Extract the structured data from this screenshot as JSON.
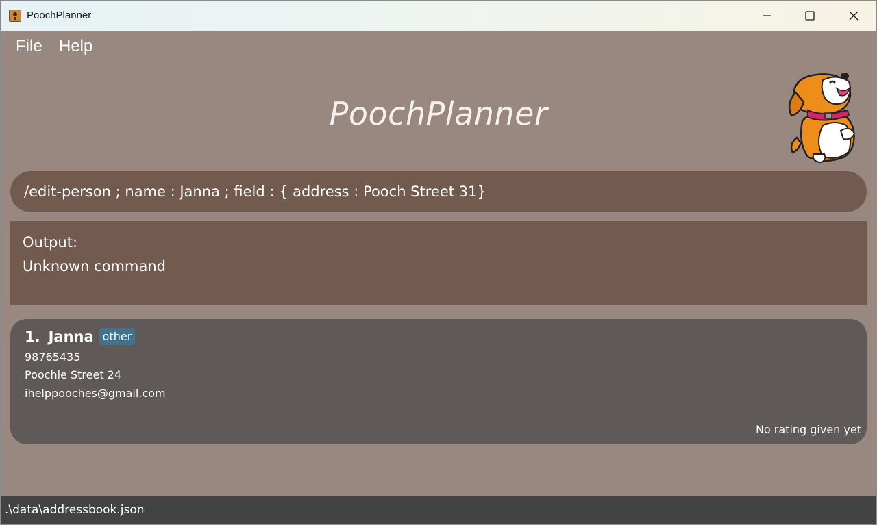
{
  "window": {
    "title": "PoochPlanner"
  },
  "menu": {
    "file_label": "File",
    "help_label": "Help"
  },
  "app": {
    "title": "PoochPlanner"
  },
  "command": {
    "value": "/edit-person ; name : Janna ; field : { address : Pooch Street 31}"
  },
  "output": {
    "label": "Output:",
    "message": "Unknown command"
  },
  "contacts": [
    {
      "index": "1.",
      "name": "Janna",
      "tag": "other",
      "phone": "98765435",
      "address": "Poochie Street 24",
      "email": "ihelppooches@gmail.com",
      "rating": "No rating given yet"
    }
  ],
  "status": {
    "path": ".\\data\\addressbook.json"
  },
  "icons": {
    "app": "dog-app-icon",
    "mascot": "dog-mascot",
    "minimize": "minimize-icon",
    "maximize": "maximize-icon",
    "close": "close-icon"
  },
  "colors": {
    "background": "#988880",
    "command_box": "#735a4f",
    "output_panel": "#735a4f",
    "card": "#5f5a57",
    "tag": "#3e7490",
    "statusbar": "#434343"
  }
}
